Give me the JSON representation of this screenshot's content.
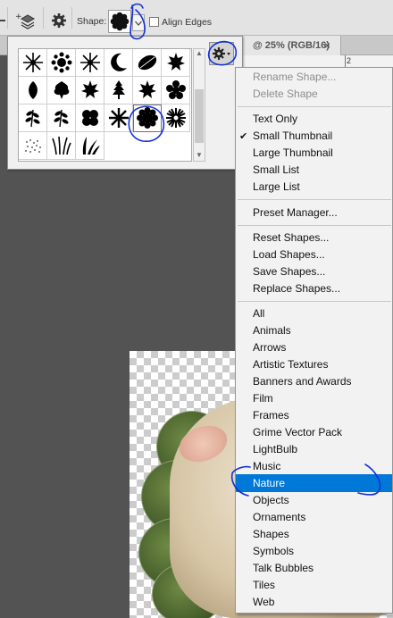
{
  "options_bar": {
    "shape_label": "Shape:",
    "align_edges_label": "Align Edges",
    "align_edges_checked": false
  },
  "document_tab": {
    "label": "@ 25% (RGB/16)",
    "close_glyph": "×"
  },
  "ruler": {
    "number": "2"
  },
  "shape_picker": {
    "shapes": [
      "snowflake-1",
      "snowflake-2",
      "snowflake-3",
      "crescent-moon",
      "leaf-1",
      "leaf-2",
      "leaf-3",
      "leaf-4",
      "leaf-5",
      "leaf-6",
      "leaf-7",
      "leaf-8",
      "fern-1",
      "fern-2",
      "flower-1",
      "flower-2",
      "flower-3-selected",
      "flower-4",
      "grass-dots",
      "grass-1",
      "grass-2"
    ],
    "selected_index": 16
  },
  "menu": {
    "group1": [
      {
        "label": "Rename Shape...",
        "disabled": true
      },
      {
        "label": "Delete Shape",
        "disabled": true
      }
    ],
    "group2": [
      {
        "label": "Text Only",
        "checked": false
      },
      {
        "label": "Small Thumbnail",
        "checked": true
      },
      {
        "label": "Large Thumbnail",
        "checked": false
      },
      {
        "label": "Small List",
        "checked": false
      },
      {
        "label": "Large List",
        "checked": false
      }
    ],
    "group3": [
      {
        "label": "Preset Manager..."
      }
    ],
    "group4": [
      {
        "label": "Reset Shapes..."
      },
      {
        "label": "Load Shapes..."
      },
      {
        "label": "Save Shapes..."
      },
      {
        "label": "Replace Shapes..."
      }
    ],
    "group5": [
      {
        "label": "All"
      },
      {
        "label": "Animals"
      },
      {
        "label": "Arrows"
      },
      {
        "label": "Artistic Textures"
      },
      {
        "label": "Banners and Awards"
      },
      {
        "label": "Film"
      },
      {
        "label": "Frames"
      },
      {
        "label": "Grime Vector Pack"
      },
      {
        "label": "LightBulb"
      },
      {
        "label": "Music"
      },
      {
        "label": "Nature"
      },
      {
        "label": "Objects"
      },
      {
        "label": "Ornaments"
      },
      {
        "label": "Shapes"
      },
      {
        "label": "Symbols"
      },
      {
        "label": "Talk Bubbles"
      },
      {
        "label": "Tiles"
      },
      {
        "label": "Web"
      }
    ],
    "highlighted": "Nature",
    "check_glyph": "✔"
  },
  "colors": {
    "menu_highlight": "#0078d7",
    "annotation": "#1432d6"
  }
}
